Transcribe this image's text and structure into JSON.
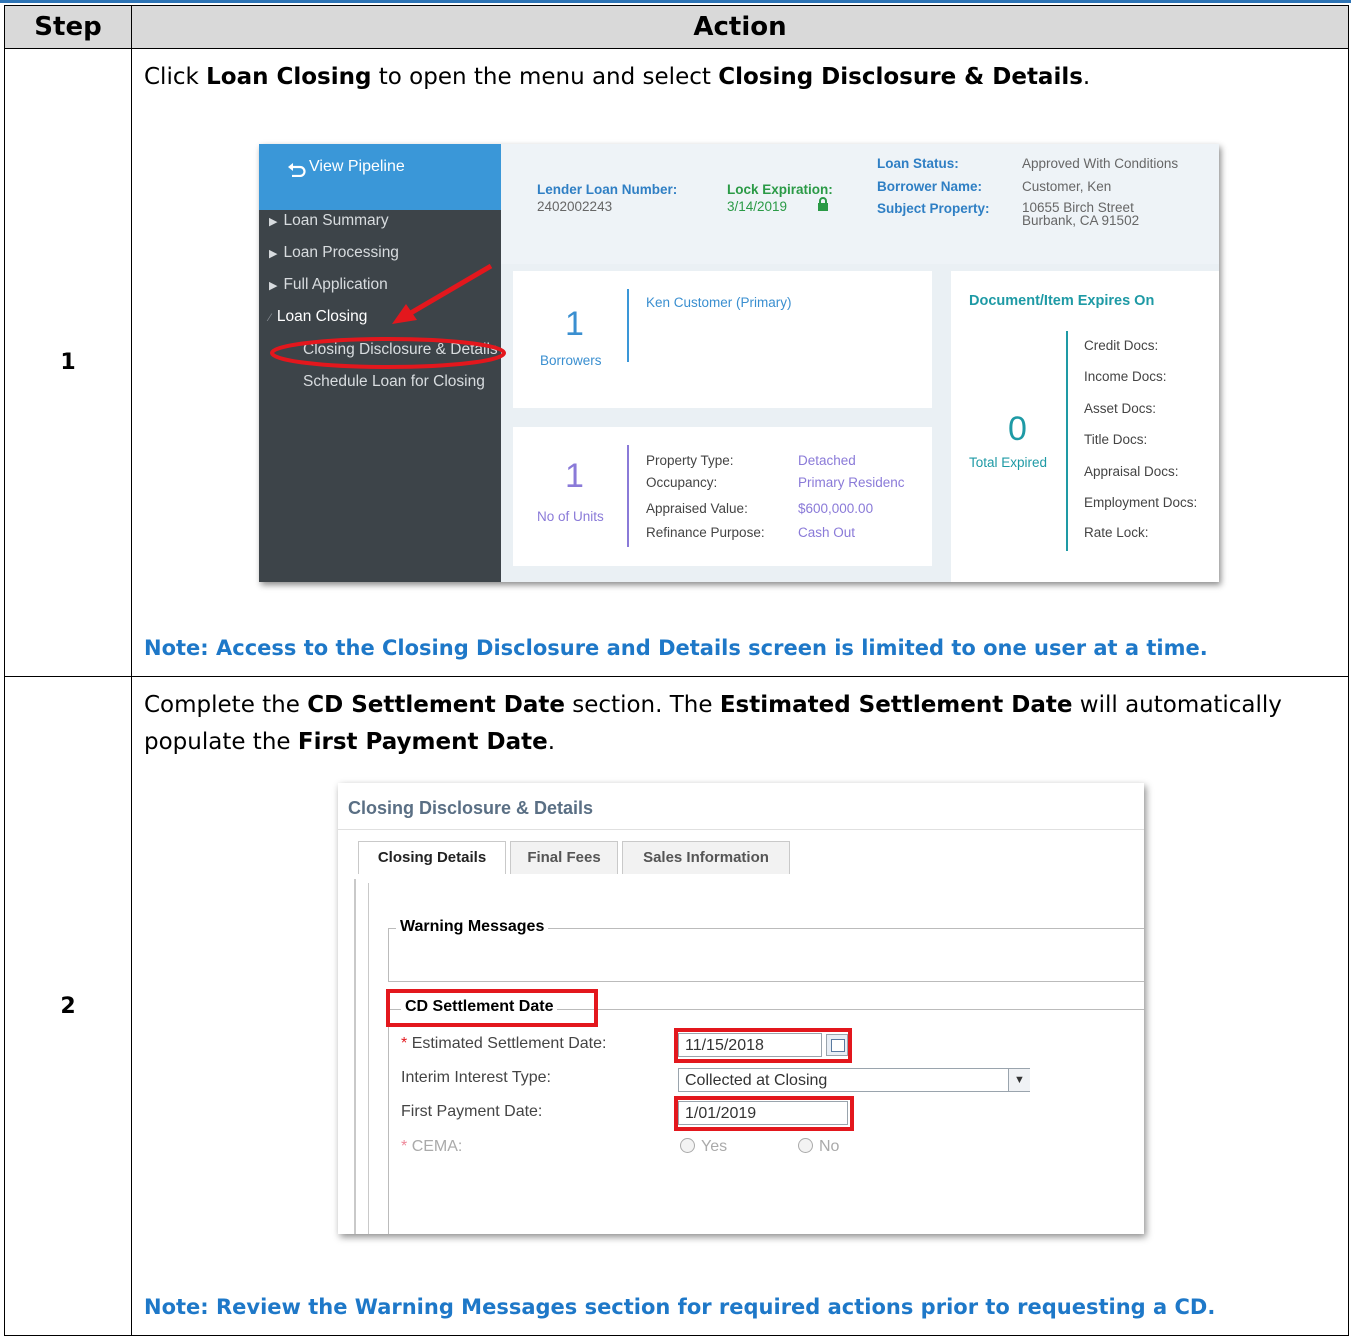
{
  "table": {
    "headers": [
      "Step",
      "Action"
    ],
    "rows": [
      {
        "step": "1",
        "instruction_parts": [
          "Click ",
          "Loan Closing",
          " to open the menu and select ",
          "Closing Disclosure & Details",
          "."
        ],
        "note": "Note:  Access to the Closing Disclosure and Details screen is limited to one user at a time."
      },
      {
        "step": "2",
        "instruction_parts": [
          "Complete the ",
          "CD Settlement Date",
          " section. The ",
          "Estimated Settlement Date",
          " will automatically populate the ",
          "First Payment Date",
          "."
        ],
        "note": "Note: Review the Warning Messages section for required actions prior to requesting a CD."
      }
    ]
  },
  "screenshot1": {
    "sidebar": {
      "view_pipeline": "View Pipeline",
      "items": [
        "Loan Summary",
        "Loan Processing",
        "Full Application",
        "Loan Closing"
      ],
      "subitems": [
        "Closing Disclosure & Details",
        "Schedule Loan for Closing"
      ]
    },
    "header": {
      "lender_loan_number_label": "Lender Loan Number:",
      "lender_loan_number": "2402002243",
      "lock_expiration_label": "Lock Expiration:",
      "lock_expiration": "3/14/2019",
      "loan_status_label": "Loan Status:",
      "loan_status": "Approved With Conditions",
      "borrower_name_label": "Borrower Name:",
      "borrower_name": "Customer, Ken",
      "subject_property_label": "Subject Property:",
      "subject_property_line1": "10655 Birch Street",
      "subject_property_line2": "Burbank, CA 91502"
    },
    "borrowers_card": {
      "count": "1",
      "caption": "Borrowers",
      "primary": "Ken Customer (Primary)"
    },
    "units_card": {
      "count": "1",
      "caption": "No of Units",
      "fields": [
        {
          "label": "Property Type:",
          "value": "Detached"
        },
        {
          "label": "Occupancy:",
          "value": "Primary Residenc"
        },
        {
          "label": "Appraised Value:",
          "value": "$600,000.00"
        },
        {
          "label": "Refinance Purpose:",
          "value": "Cash Out"
        }
      ]
    },
    "expires_card": {
      "title": "Document/Item Expires On",
      "count": "0",
      "caption": "Total Expired",
      "docs": [
        "Credit Docs:",
        "Income Docs:",
        "Asset Docs:",
        "Title Docs:",
        "Appraisal Docs:",
        "Employment Docs:",
        "Rate Lock:"
      ]
    },
    "colors": {
      "sidebar": "#3d4449",
      "accent": "#3a97d8",
      "annotation": "#e3171d"
    }
  },
  "screenshot2": {
    "title": "Closing Disclosure & Details",
    "tabs": [
      "Closing Details",
      "Final Fees",
      "Sales Information"
    ],
    "warning_legend": "Warning Messages",
    "cd_legend": "CD Settlement Date",
    "required_mark": "*",
    "fields": {
      "estimated_label": "Estimated Settlement Date:",
      "estimated_value": "11/15/2018",
      "interim_label": "Interim Interest Type:",
      "interim_value": "Collected at Closing",
      "first_payment_label": "First Payment Date:",
      "first_payment_value": "1/01/2019",
      "cema_label": "CEMA:",
      "cema_options": [
        "Yes",
        "No"
      ]
    }
  }
}
